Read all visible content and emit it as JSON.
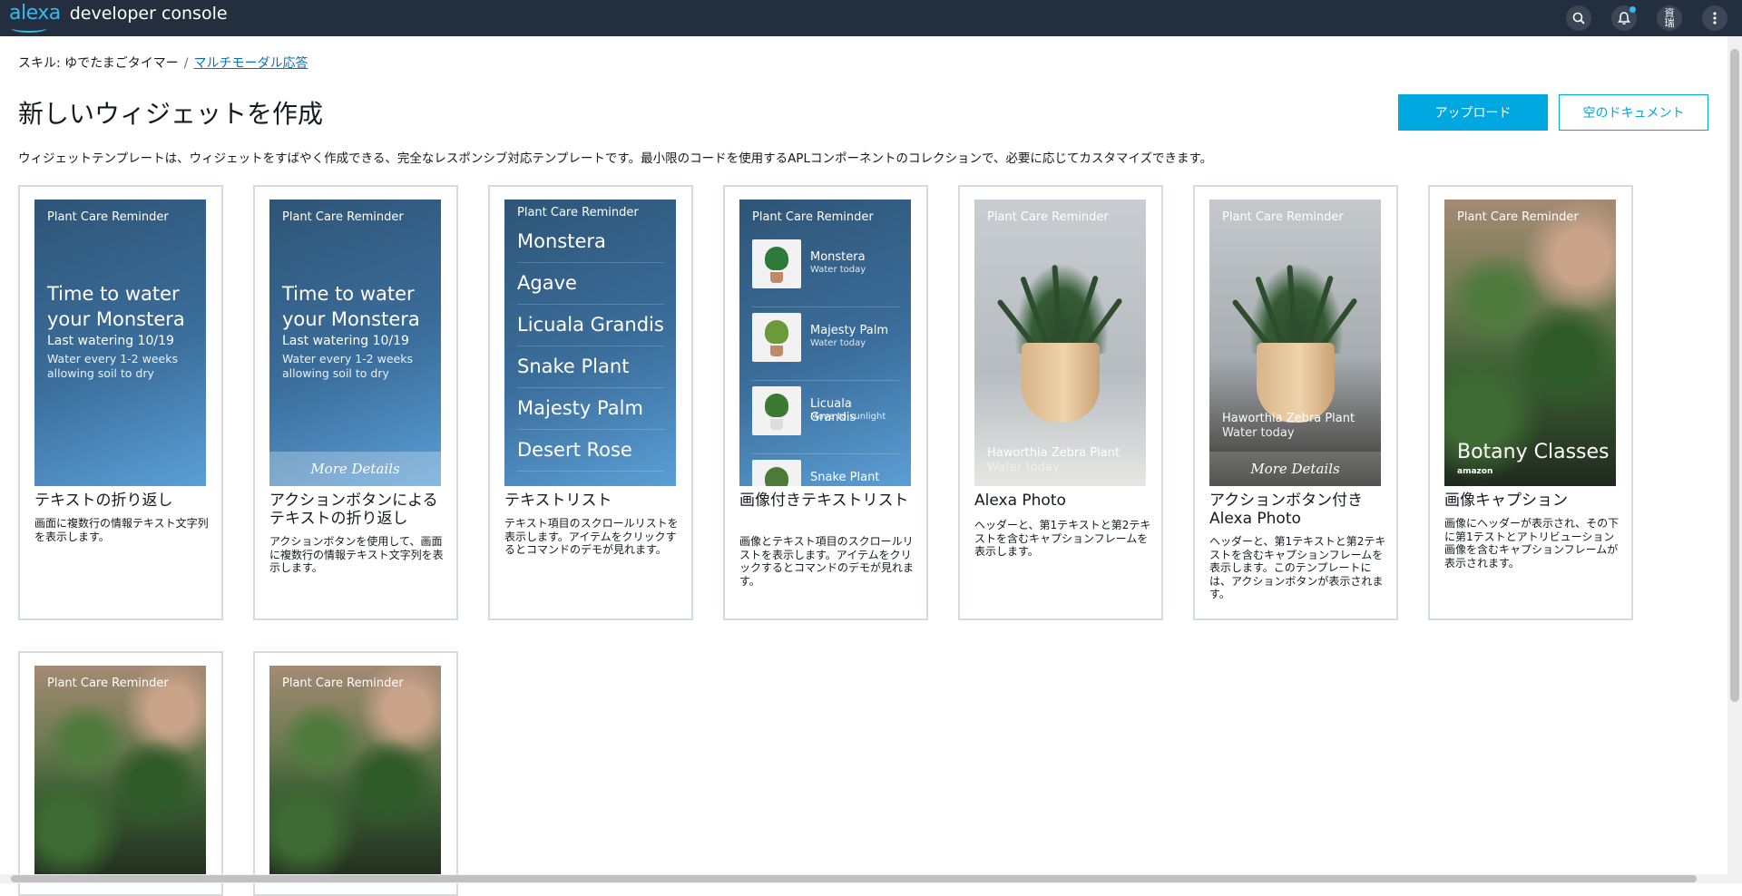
{
  "topbar": {
    "brand_name": "alexa",
    "brand_suffix": "developer console",
    "icons": [
      "search-icon",
      "notification-bell-icon",
      "account-icon",
      "more-vertical-icon"
    ],
    "account_initials": "資 瑞"
  },
  "breadcrumb": {
    "root": "スキル: ゆでたまごタイマー",
    "separator": "/",
    "current": "マルチモーダル応答"
  },
  "page": {
    "title": "新しいウィジェットを作成",
    "upload_button": "アップロード",
    "empty_doc_button": "空のドキュメント",
    "description": "ウィジェットテンプレートは、ウィジェットをすばやく作成できる、完全なレスポンシブ対応テンプレートです。最小限のコードを使用するAPLコンポーネントのコレクションで、必要に応じてカスタマイズできます。"
  },
  "preview_text": {
    "header": "Plant Care Reminder",
    "big_text": "Time to water your Monstera",
    "last_watering": "Last watering 10/19",
    "water_every": "Water every 1-2 weeks allowing soil to dry",
    "more_details": "More Details",
    "text_list": [
      "Monstera",
      "Agave",
      "Licuala Grandis",
      "Snake Plant",
      "Majesty Palm",
      "Desert Rose"
    ],
    "image_list": [
      {
        "name": "Monstera",
        "sub": "Water today"
      },
      {
        "name": "Majesty Palm",
        "sub": "Water today"
      },
      {
        "name": "Licuala Grandis",
        "sub": "Move to sunlight"
      },
      {
        "name": "Snake Plant",
        "sub": ""
      }
    ],
    "photo_primary": "Haworthia Zebra Plant",
    "photo_secondary": "Water today",
    "botany_title": "Botany Classes",
    "amazon_mark": "amazon"
  },
  "cards": [
    {
      "title": "テキストの折り返し",
      "desc": "画面に複数行の情報テキスト文字列を表示します。"
    },
    {
      "title": "アクションボタンによるテキストの折り返し",
      "desc": "アクションボタンを使用して、画面に複数行の情報テキスト文字列を表示します。"
    },
    {
      "title": "テキストリスト",
      "desc": "テキスト項目のスクロールリストを表示します。アイテムをクリックするとコマンドのデモが見れます。"
    },
    {
      "title": "画像付きテキストリスト",
      "desc": "画像とテキスト項目のスクロールリストを表示します。アイテムをクリックするとコマンドのデモが見れます。"
    },
    {
      "title": "Alexa Photo",
      "desc": "ヘッダーと、第1テキストと第2テキストを含むキャプションフレームを表示します。"
    },
    {
      "title": "アクションボタン付きAlexa Photo",
      "desc": "ヘッダーと、第1テキストと第2テキストを含むキャプションフレームを表示します。このテンプレートには、アクションボタンが表示されます。"
    },
    {
      "title": "画像キャプション",
      "desc": "画像にヘッダーが表示され、その下に第1テストとアトリビューション画像を含むキャプションフレームが表示されます。"
    }
  ]
}
